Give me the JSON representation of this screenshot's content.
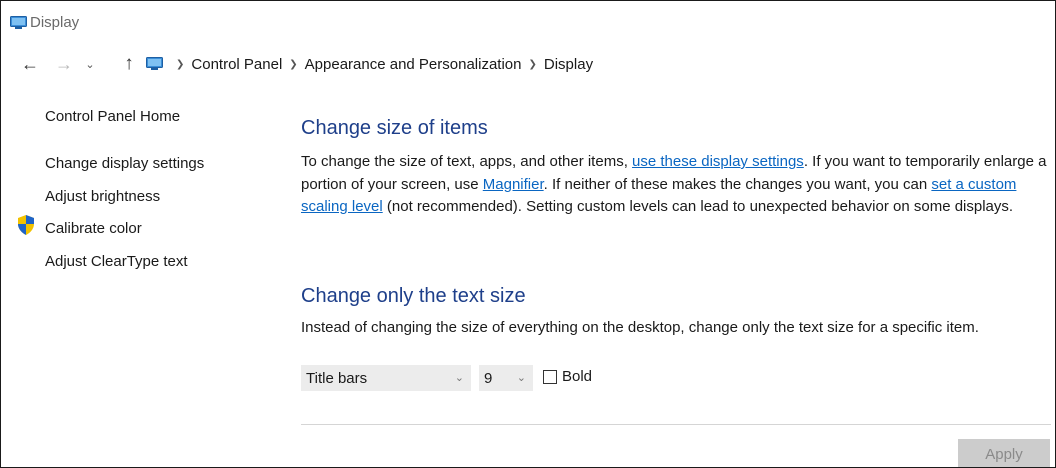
{
  "window": {
    "title": "Display",
    "title_icon": "display-icon"
  },
  "nav": {
    "back_icon": "arrow-left-icon",
    "forward_icon": "arrow-right-icon",
    "recent_icon": "chevron-down-icon",
    "up_icon": "arrow-up-icon",
    "breadcrumb": [
      "Control Panel",
      "Appearance and Personalization",
      "Display"
    ]
  },
  "sidebar": {
    "home": "Control Panel Home",
    "links": [
      "Change display settings",
      "Adjust brightness",
      "Calibrate color",
      "Adjust ClearType text"
    ],
    "shield_icon": "uac-shield-icon"
  },
  "main": {
    "size_heading": "Change size of items",
    "para_1": "To change the size of text, apps, and other items, ",
    "link_1": "use these display settings",
    "para_2": ".  If you want to temporarily enlarge a portion of your screen, use ",
    "link_2": "Magnifier",
    "para_3": ".  If neither of these makes the changes you want, you can ",
    "link_3": "set a custom scaling level",
    "para_4": " (not recommended).  Setting custom levels can lead to unexpected behavior on some displays.",
    "text_heading": "Change only the text size",
    "text_desc": "Instead of changing the size of everything on the desktop, change only the text size for a specific item.",
    "item_select": "Title bars",
    "size_select": "9",
    "bold_label": "Bold",
    "bold_checked": false,
    "apply": "Apply"
  },
  "colors": {
    "heading": "#1e3f8a",
    "link": "#0a66c2",
    "apply_disabled_bg": "#cccccc"
  }
}
